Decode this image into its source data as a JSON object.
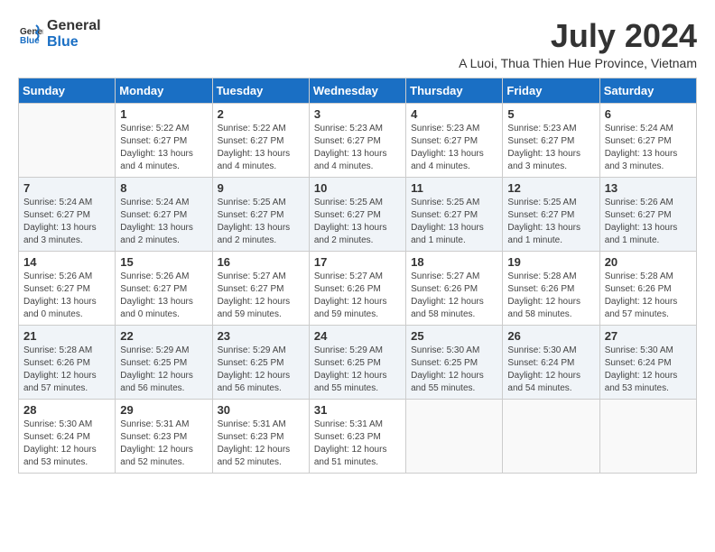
{
  "logo": {
    "general": "General",
    "blue": "Blue"
  },
  "header": {
    "month_year": "July 2024",
    "location": "A Luoi, Thua Thien Hue Province, Vietnam"
  },
  "days_of_week": [
    "Sunday",
    "Monday",
    "Tuesday",
    "Wednesday",
    "Thursday",
    "Friday",
    "Saturday"
  ],
  "weeks": [
    [
      {
        "day": "",
        "lines": []
      },
      {
        "day": "1",
        "lines": [
          "Sunrise: 5:22 AM",
          "Sunset: 6:27 PM",
          "Daylight: 13 hours",
          "and 4 minutes."
        ]
      },
      {
        "day": "2",
        "lines": [
          "Sunrise: 5:22 AM",
          "Sunset: 6:27 PM",
          "Daylight: 13 hours",
          "and 4 minutes."
        ]
      },
      {
        "day": "3",
        "lines": [
          "Sunrise: 5:23 AM",
          "Sunset: 6:27 PM",
          "Daylight: 13 hours",
          "and 4 minutes."
        ]
      },
      {
        "day": "4",
        "lines": [
          "Sunrise: 5:23 AM",
          "Sunset: 6:27 PM",
          "Daylight: 13 hours",
          "and 4 minutes."
        ]
      },
      {
        "day": "5",
        "lines": [
          "Sunrise: 5:23 AM",
          "Sunset: 6:27 PM",
          "Daylight: 13 hours",
          "and 3 minutes."
        ]
      },
      {
        "day": "6",
        "lines": [
          "Sunrise: 5:24 AM",
          "Sunset: 6:27 PM",
          "Daylight: 13 hours",
          "and 3 minutes."
        ]
      }
    ],
    [
      {
        "day": "7",
        "lines": [
          "Sunrise: 5:24 AM",
          "Sunset: 6:27 PM",
          "Daylight: 13 hours",
          "and 3 minutes."
        ]
      },
      {
        "day": "8",
        "lines": [
          "Sunrise: 5:24 AM",
          "Sunset: 6:27 PM",
          "Daylight: 13 hours",
          "and 2 minutes."
        ]
      },
      {
        "day": "9",
        "lines": [
          "Sunrise: 5:25 AM",
          "Sunset: 6:27 PM",
          "Daylight: 13 hours",
          "and 2 minutes."
        ]
      },
      {
        "day": "10",
        "lines": [
          "Sunrise: 5:25 AM",
          "Sunset: 6:27 PM",
          "Daylight: 13 hours",
          "and 2 minutes."
        ]
      },
      {
        "day": "11",
        "lines": [
          "Sunrise: 5:25 AM",
          "Sunset: 6:27 PM",
          "Daylight: 13 hours",
          "and 1 minute."
        ]
      },
      {
        "day": "12",
        "lines": [
          "Sunrise: 5:25 AM",
          "Sunset: 6:27 PM",
          "Daylight: 13 hours",
          "and 1 minute."
        ]
      },
      {
        "day": "13",
        "lines": [
          "Sunrise: 5:26 AM",
          "Sunset: 6:27 PM",
          "Daylight: 13 hours",
          "and 1 minute."
        ]
      }
    ],
    [
      {
        "day": "14",
        "lines": [
          "Sunrise: 5:26 AM",
          "Sunset: 6:27 PM",
          "Daylight: 13 hours",
          "and 0 minutes."
        ]
      },
      {
        "day": "15",
        "lines": [
          "Sunrise: 5:26 AM",
          "Sunset: 6:27 PM",
          "Daylight: 13 hours",
          "and 0 minutes."
        ]
      },
      {
        "day": "16",
        "lines": [
          "Sunrise: 5:27 AM",
          "Sunset: 6:27 PM",
          "Daylight: 12 hours",
          "and 59 minutes."
        ]
      },
      {
        "day": "17",
        "lines": [
          "Sunrise: 5:27 AM",
          "Sunset: 6:26 PM",
          "Daylight: 12 hours",
          "and 59 minutes."
        ]
      },
      {
        "day": "18",
        "lines": [
          "Sunrise: 5:27 AM",
          "Sunset: 6:26 PM",
          "Daylight: 12 hours",
          "and 58 minutes."
        ]
      },
      {
        "day": "19",
        "lines": [
          "Sunrise: 5:28 AM",
          "Sunset: 6:26 PM",
          "Daylight: 12 hours",
          "and 58 minutes."
        ]
      },
      {
        "day": "20",
        "lines": [
          "Sunrise: 5:28 AM",
          "Sunset: 6:26 PM",
          "Daylight: 12 hours",
          "and 57 minutes."
        ]
      }
    ],
    [
      {
        "day": "21",
        "lines": [
          "Sunrise: 5:28 AM",
          "Sunset: 6:26 PM",
          "Daylight: 12 hours",
          "and 57 minutes."
        ]
      },
      {
        "day": "22",
        "lines": [
          "Sunrise: 5:29 AM",
          "Sunset: 6:25 PM",
          "Daylight: 12 hours",
          "and 56 minutes."
        ]
      },
      {
        "day": "23",
        "lines": [
          "Sunrise: 5:29 AM",
          "Sunset: 6:25 PM",
          "Daylight: 12 hours",
          "and 56 minutes."
        ]
      },
      {
        "day": "24",
        "lines": [
          "Sunrise: 5:29 AM",
          "Sunset: 6:25 PM",
          "Daylight: 12 hours",
          "and 55 minutes."
        ]
      },
      {
        "day": "25",
        "lines": [
          "Sunrise: 5:30 AM",
          "Sunset: 6:25 PM",
          "Daylight: 12 hours",
          "and 55 minutes."
        ]
      },
      {
        "day": "26",
        "lines": [
          "Sunrise: 5:30 AM",
          "Sunset: 6:24 PM",
          "Daylight: 12 hours",
          "and 54 minutes."
        ]
      },
      {
        "day": "27",
        "lines": [
          "Sunrise: 5:30 AM",
          "Sunset: 6:24 PM",
          "Daylight: 12 hours",
          "and 53 minutes."
        ]
      }
    ],
    [
      {
        "day": "28",
        "lines": [
          "Sunrise: 5:30 AM",
          "Sunset: 6:24 PM",
          "Daylight: 12 hours",
          "and 53 minutes."
        ]
      },
      {
        "day": "29",
        "lines": [
          "Sunrise: 5:31 AM",
          "Sunset: 6:23 PM",
          "Daylight: 12 hours",
          "and 52 minutes."
        ]
      },
      {
        "day": "30",
        "lines": [
          "Sunrise: 5:31 AM",
          "Sunset: 6:23 PM",
          "Daylight: 12 hours",
          "and 52 minutes."
        ]
      },
      {
        "day": "31",
        "lines": [
          "Sunrise: 5:31 AM",
          "Sunset: 6:23 PM",
          "Daylight: 12 hours",
          "and 51 minutes."
        ]
      },
      {
        "day": "",
        "lines": []
      },
      {
        "day": "",
        "lines": []
      },
      {
        "day": "",
        "lines": []
      }
    ]
  ]
}
